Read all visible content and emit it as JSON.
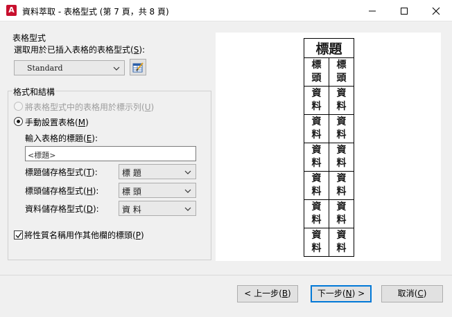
{
  "window": {
    "title": "資料萃取 - 表格型式 (第 7 頁，共 8 頁)",
    "app_icon_letter": "A",
    "app_icon_color": "#c8102e"
  },
  "table_style": {
    "group_label": "表格型式",
    "select_label": "選取用於已插入表格的表格型式",
    "select_label_key": "S",
    "select_value": "Standard",
    "edit_button_icon": "table-style-edit-icon"
  },
  "format": {
    "group_label": "格式和結構",
    "option_legend": {
      "label": "將表格型式中的表格用於標示列",
      "key": "U",
      "checked": false,
      "enabled": false
    },
    "option_manual": {
      "label": "手動設置表格",
      "key": "M",
      "checked": true
    },
    "title_input_label": "輸入表格的標題",
    "title_input_key": "E",
    "title_input_value": "<標題>",
    "title_cell": {
      "label": "標題儲存格型式",
      "key": "T",
      "value": "標 題"
    },
    "header_cell": {
      "label": "標頭儲存格型式",
      "key": "H",
      "value": "標 頭"
    },
    "data_cell": {
      "label": "資料儲存格型式",
      "key": "D",
      "value": "資 料"
    },
    "use_names_checkbox": {
      "label": "將性質名稱用作其他欄的標頭",
      "key": "P",
      "checked": true
    }
  },
  "preview": {
    "title": "標題",
    "header_cells": [
      "標頭",
      "標頭"
    ],
    "data_rows": [
      [
        "資料",
        "資料"
      ],
      [
        "資料",
        "資料"
      ],
      [
        "資料",
        "資料"
      ],
      [
        "資料",
        "資料"
      ],
      [
        "資料",
        "資料"
      ],
      [
        "資料",
        "資料"
      ]
    ]
  },
  "buttons": {
    "back": {
      "label": "< 上一步",
      "key": "B"
    },
    "next": {
      "label": "下一步",
      "key": "N",
      "suffix": " >"
    },
    "cancel": {
      "label": "取消",
      "key": "C"
    }
  },
  "colors": {
    "accent": "#0078d7",
    "dialog_bg": "#f0f0f0"
  }
}
